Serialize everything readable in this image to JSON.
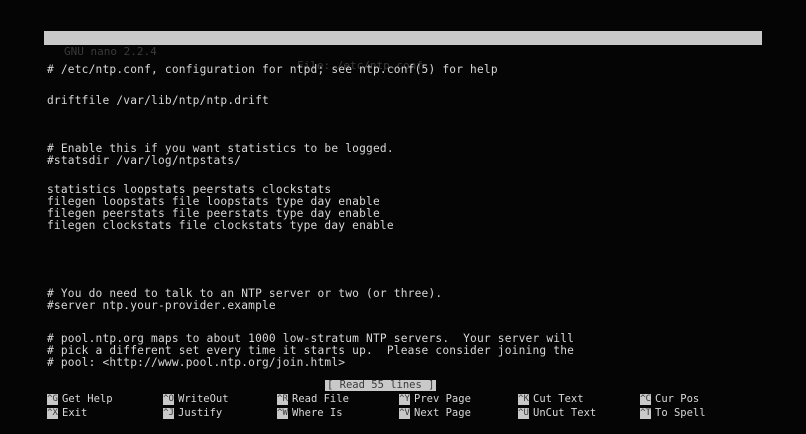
{
  "titlebar": {
    "version": "GNU nano 2.2.4",
    "file_label": "File: /etc/ntp.conf"
  },
  "lines": [
    "# /etc/ntp.conf, configuration for ntpd; see ntp.conf(5) for help",
    "",
    "driftfile /var/lib/ntp/ntp.drift",
    "",
    "",
    "# Enable this if you want statistics to be logged.",
    "#statsdir /var/log/ntpstats/",
    "",
    "statistics loopstats peerstats clockstats",
    "filegen loopstats file loopstats type day enable",
    "filegen peerstats file peerstats type day enable",
    "filegen clockstats file clockstats type day enable",
    "",
    "",
    "",
    "# You do need to talk to an NTP server or two (or three).",
    "#server ntp.your-provider.example",
    "",
    "# pool.ntp.org maps to about 1000 low-stratum NTP servers.  Your server will",
    "# pick a different set every time it starts up.  Please consider joining the",
    "# pool: <http://www.pool.ntp.org/join.html>"
  ],
  "status": "[ Read 55 lines ]",
  "shortcuts": [
    {
      "key": "^G",
      "label": "Get Help"
    },
    {
      "key": "^O",
      "label": "WriteOut"
    },
    {
      "key": "^R",
      "label": "Read File"
    },
    {
      "key": "^Y",
      "label": "Prev Page"
    },
    {
      "key": "^K",
      "label": "Cut Text"
    },
    {
      "key": "^C",
      "label": "Cur Pos"
    },
    {
      "key": "^X",
      "label": "Exit"
    },
    {
      "key": "^J",
      "label": "Justify"
    },
    {
      "key": "^W",
      "label": "Where Is"
    },
    {
      "key": "^V",
      "label": "Next Page"
    },
    {
      "key": "^U",
      "label": "UnCut Text"
    },
    {
      "key": "^T",
      "label": "To Spell"
    }
  ]
}
